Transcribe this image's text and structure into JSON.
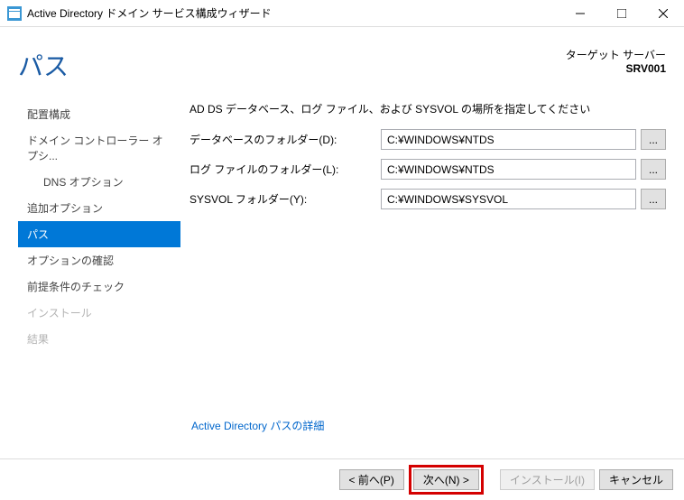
{
  "window": {
    "title": "Active Directory ドメイン サービス構成ウィザード"
  },
  "header": {
    "pageTitle": "パス",
    "targetLabel": "ターゲット サーバー",
    "targetName": "SRV001"
  },
  "sidebar": {
    "items": [
      {
        "label": "配置構成",
        "indent": false,
        "disabled": false,
        "active": false
      },
      {
        "label": "ドメイン コントローラー オプシ...",
        "indent": false,
        "disabled": false,
        "active": false
      },
      {
        "label": "DNS オプション",
        "indent": true,
        "disabled": false,
        "active": false
      },
      {
        "label": "追加オプション",
        "indent": false,
        "disabled": false,
        "active": false
      },
      {
        "label": "パス",
        "indent": false,
        "disabled": false,
        "active": true
      },
      {
        "label": "オプションの確認",
        "indent": false,
        "disabled": false,
        "active": false
      },
      {
        "label": "前提条件のチェック",
        "indent": false,
        "disabled": false,
        "active": false
      },
      {
        "label": "インストール",
        "indent": false,
        "disabled": true,
        "active": false
      },
      {
        "label": "結果",
        "indent": false,
        "disabled": true,
        "active": false
      }
    ]
  },
  "main": {
    "instruction": "AD DS データベース、ログ ファイル、および SYSVOL の場所を指定してください",
    "rows": [
      {
        "label": "データベースのフォルダー(D):",
        "value": "C:¥WINDOWS¥NTDS"
      },
      {
        "label": "ログ ファイルのフォルダー(L):",
        "value": "C:¥WINDOWS¥NTDS"
      },
      {
        "label": "SYSVOL フォルダー(Y):",
        "value": "C:¥WINDOWS¥SYSVOL"
      }
    ],
    "browseLabel": "...",
    "detailsLink": "Active Directory パスの詳細"
  },
  "buttons": {
    "previous": "< 前へ(P)",
    "next": "次へ(N) >",
    "install": "インストール(I)",
    "cancel": "キャンセル"
  }
}
